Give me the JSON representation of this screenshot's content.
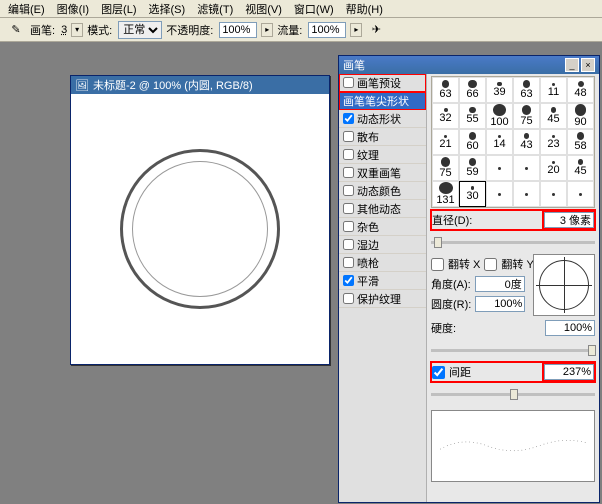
{
  "menu": [
    "编辑(E)",
    "图像(I)",
    "图层(L)",
    "选择(S)",
    "滤镜(T)",
    "视图(V)",
    "窗口(W)",
    "帮助(H)"
  ],
  "toolbar": {
    "brush_label": "画笔:",
    "brush_size": "3",
    "mode_label": "模式:",
    "mode_value": "正常",
    "opacity_label": "不透明度:",
    "opacity_value": "100%",
    "flow_label": "流量:",
    "flow_value": "100%"
  },
  "canvas": {
    "title": "未标题-2 @ 100% (内圆, RGB/8)"
  },
  "panel": {
    "title": "画笔",
    "left_items": [
      {
        "label": "画笔预设",
        "ck": false,
        "hl": true
      },
      {
        "label": "画笔笔尖形状",
        "ck": false,
        "sel": true,
        "hl": true
      },
      {
        "label": "动态形状",
        "ck": true
      },
      {
        "label": "散布",
        "ck": false
      },
      {
        "label": "纹理",
        "ck": false
      },
      {
        "label": "双重画笔",
        "ck": false
      },
      {
        "label": "动态颜色",
        "ck": false
      },
      {
        "label": "其他动态",
        "ck": false
      },
      {
        "label": "杂色",
        "ck": false
      },
      {
        "label": "湿边",
        "ck": false
      },
      {
        "label": "喷枪",
        "ck": false
      },
      {
        "label": "平滑",
        "ck": true
      },
      {
        "label": "保护纹理",
        "ck": false
      }
    ],
    "thumbs": [
      63,
      66,
      39,
      63,
      11,
      48,
      32,
      55,
      100,
      75,
      45,
      90,
      21,
      60,
      14,
      43,
      23,
      58,
      75,
      59,
      "",
      "",
      20,
      45,
      131,
      30,
      "",
      "",
      "",
      ""
    ],
    "diameter_label": "直径(D):",
    "diameter_value": "3 像素",
    "flip_x": "翻转 X",
    "flip_y": "翻转 Y",
    "angle_label": "角度(A):",
    "angle_value": "0度",
    "round_label": "圆度(R):",
    "round_value": "100%",
    "hardness_label": "硬度:",
    "hardness_value": "100%",
    "spacing_label": "间距",
    "spacing_value": "237%"
  }
}
